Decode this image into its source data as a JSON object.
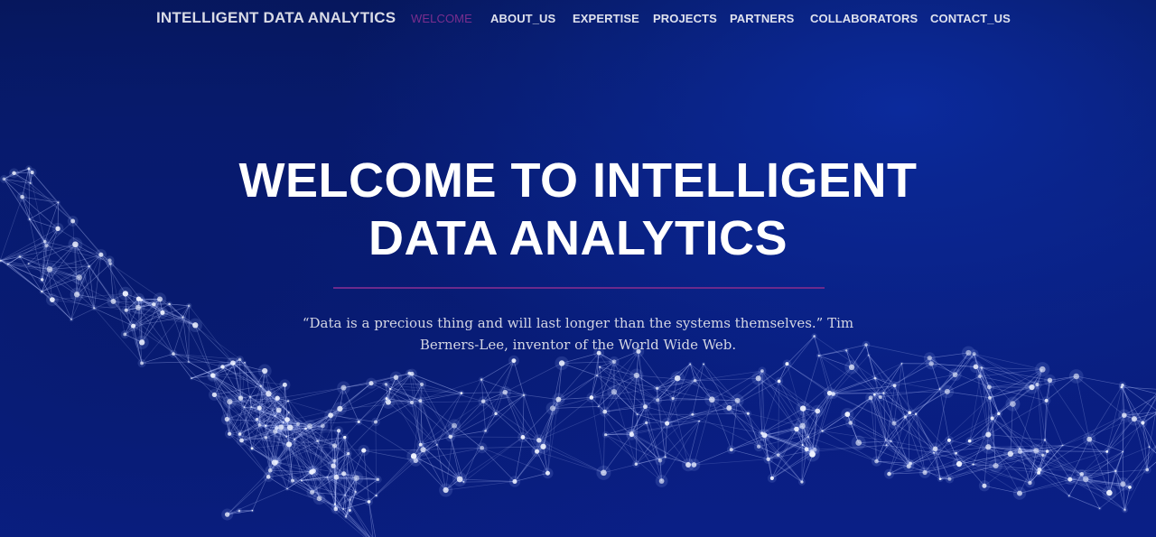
{
  "brand": {
    "title": "INTELLIGENT DATA ANALYTICS"
  },
  "nav": {
    "items": [
      {
        "label": "WELCOME",
        "active": true
      },
      {
        "label": "ABOUT_US",
        "active": false
      },
      {
        "label": "EXPERTISE",
        "active": false
      },
      {
        "label": "PROJECTS",
        "active": false
      },
      {
        "label": "PARTNERS",
        "active": false
      },
      {
        "label": "COLLABORATORS",
        "active": false
      },
      {
        "label": "CONTACT_US",
        "active": false
      }
    ]
  },
  "hero": {
    "title_line1": "WELCOME TO INTELLIGENT",
    "title_line2": "DATA ANALYTICS",
    "quote": "“Data is a precious thing and will last longer than the systems themselves.” Tim Berners-Lee, inventor of the World Wide Web."
  },
  "colors": {
    "background": "#081d7a",
    "nav_active": "#7a2e8e",
    "divider": "#6c2a8c",
    "text": "#ffffff",
    "network_lines": "#b9c6ff"
  },
  "background_image": {
    "icon": "data-network-mesh"
  }
}
